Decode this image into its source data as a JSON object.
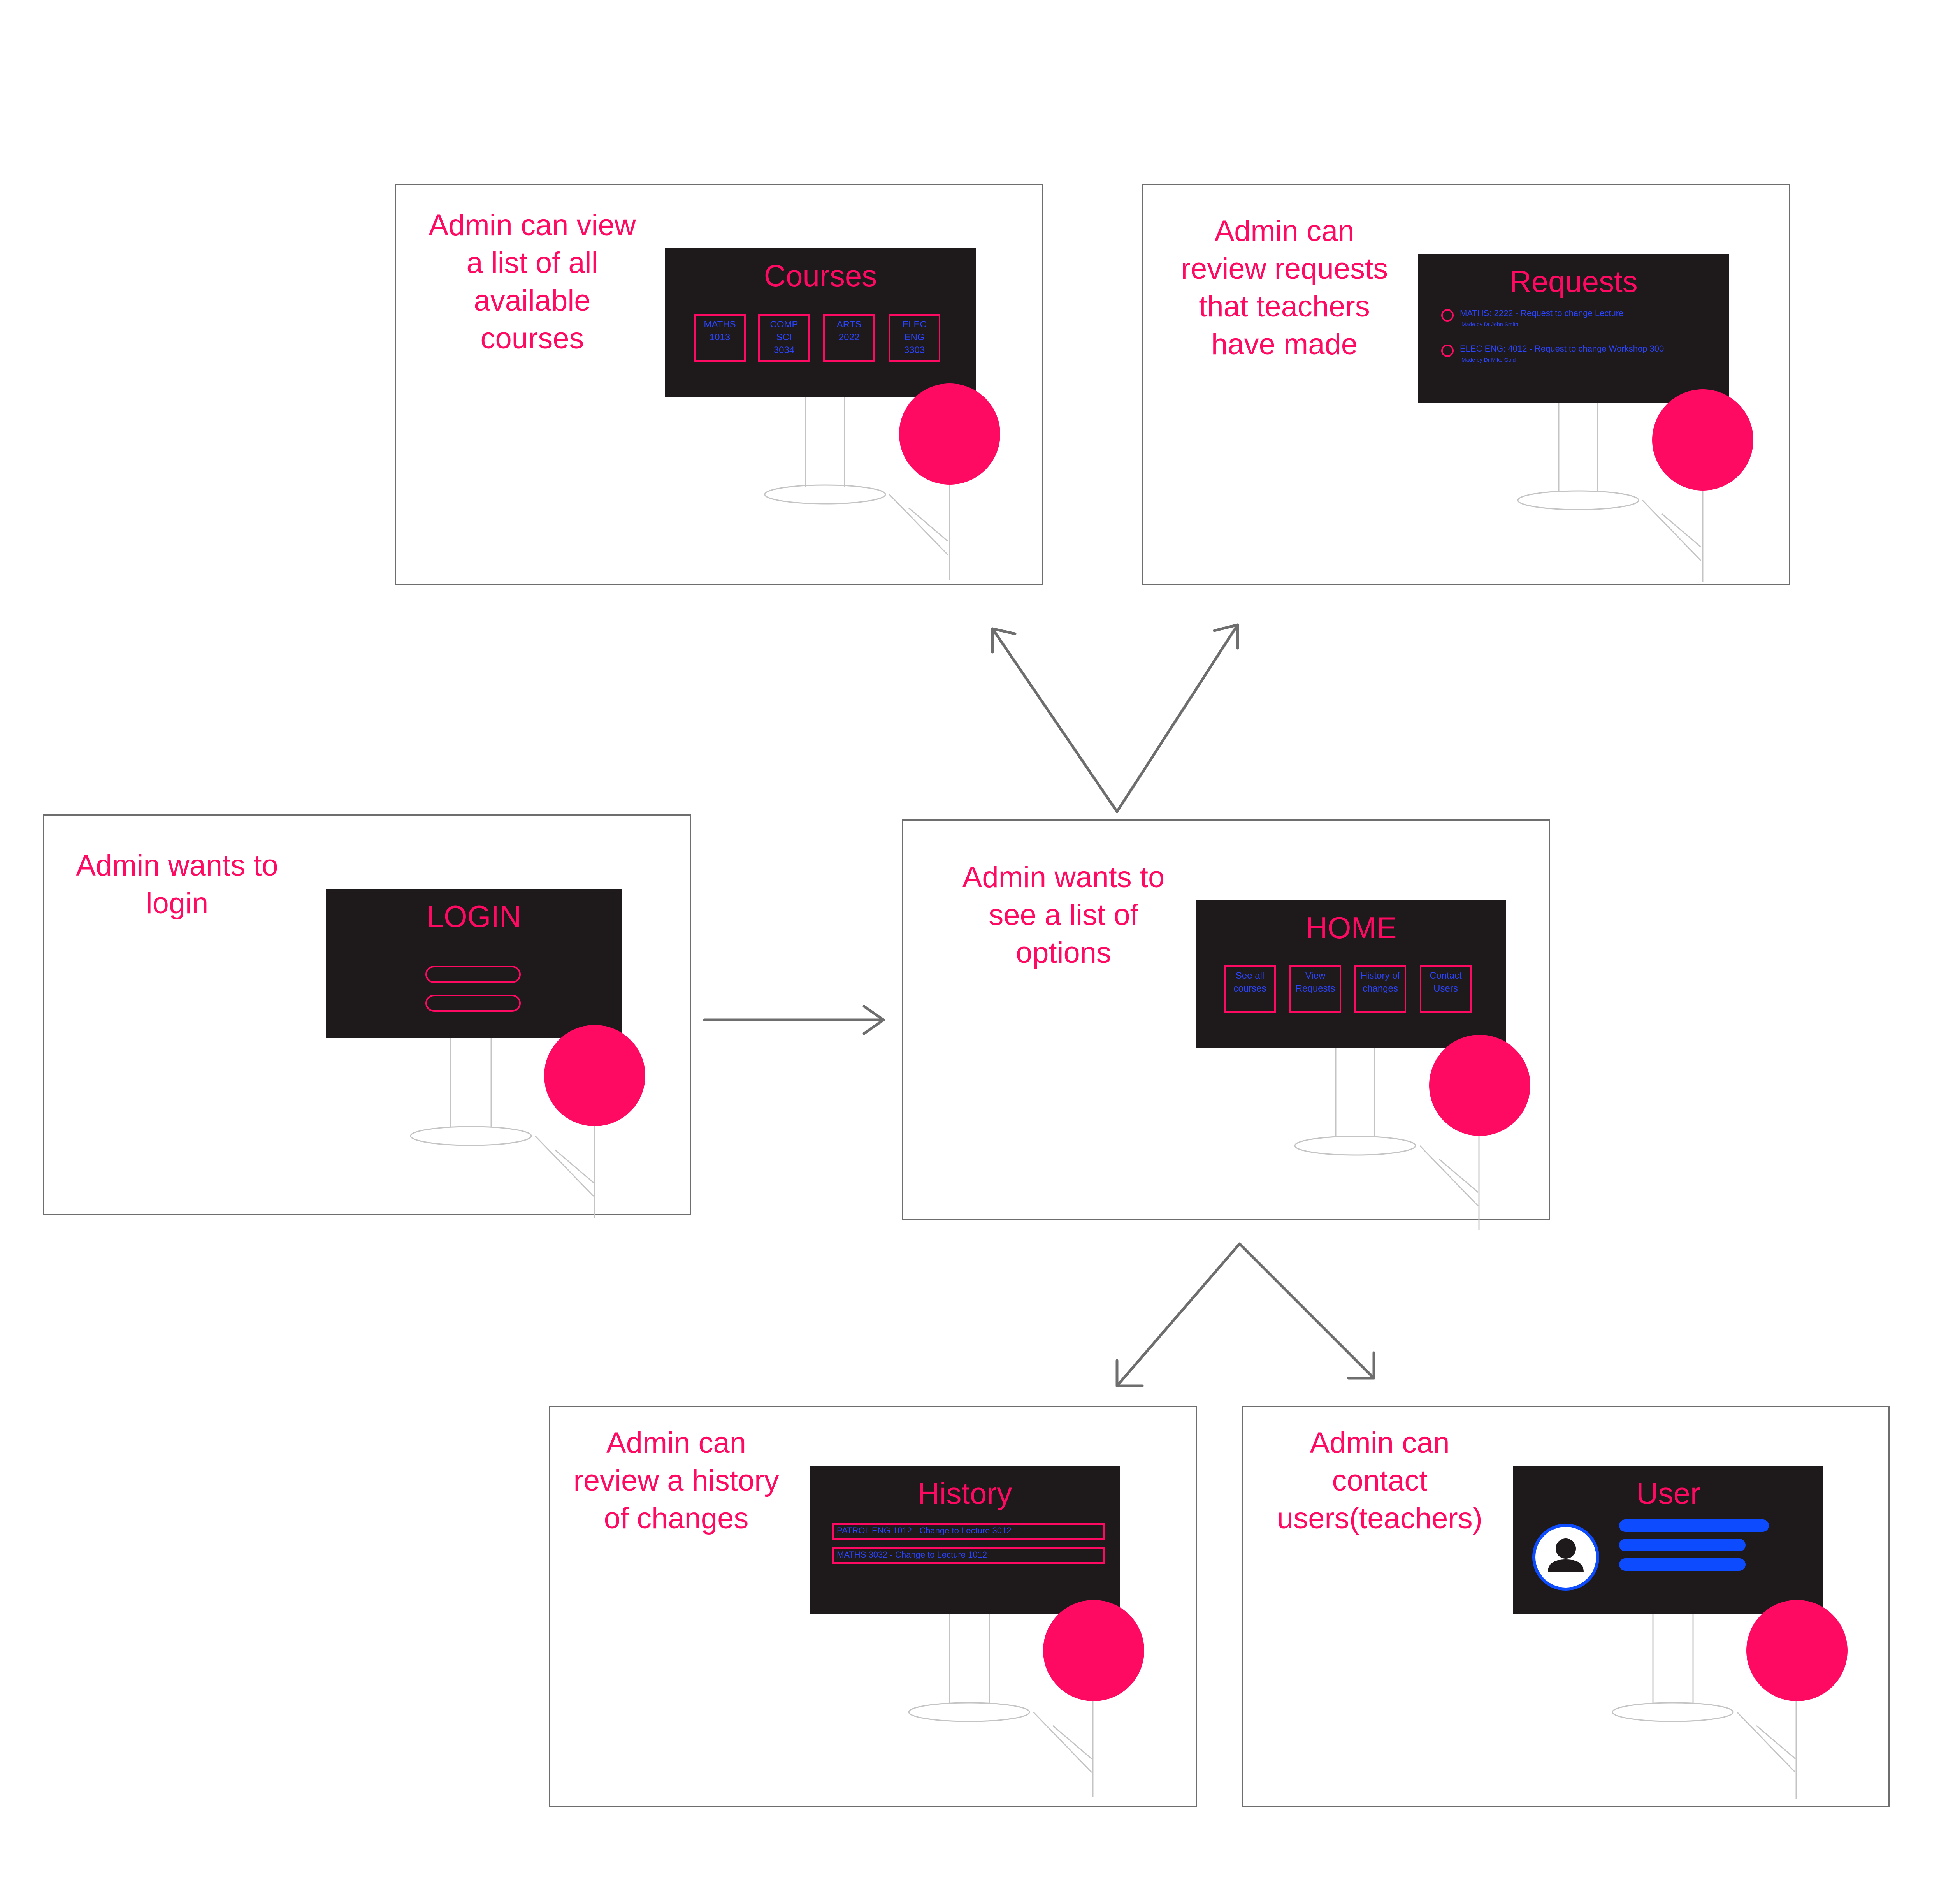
{
  "colors": {
    "accent": "#ff0a63",
    "board": "#1e191a",
    "link_text": "#2b44ff",
    "bar": "#0d4bff",
    "frame": "#6e6e6e",
    "arrow": "#6e6e6e"
  },
  "icons": {
    "avatar": "user-avatar-icon",
    "person": "person-stand-icon",
    "arrow": "arrow-icon"
  },
  "panels": {
    "courses": {
      "caption": "Admin can view\na list of all\navailable\ncourses",
      "title": "Courses",
      "tiles": [
        "MATHS\n1013",
        "COMP\nSCI\n3034",
        "ARTS\n2022",
        "ELEC\nENG\n3303"
      ]
    },
    "requests": {
      "caption": "Admin can\nreview requests\nthat teachers\nhave made",
      "title": "Requests",
      "items": [
        {
          "text": "MATHS: 2222 - Request to change Lecture",
          "by": "Made by Dr John Smith"
        },
        {
          "text": "ELEC ENG: 4012 - Request to change Workshop 300",
          "by": "Made by Dr Mike Gold"
        }
      ]
    },
    "login": {
      "caption": "Admin wants to\nlogin",
      "title": "LOGIN"
    },
    "home": {
      "caption": "Admin wants to\nsee a list of\noptions",
      "title": "HOME",
      "tiles": [
        "See all\ncourses",
        "View\nRequests",
        "History of\nchanges",
        "Contact\nUsers"
      ]
    },
    "history": {
      "caption": "Admin can\nreview a history\nof changes",
      "title": "History",
      "rows": [
        "PATROL ENG 1012 - Change to Lecture 3012",
        "MATHS 3032 - Change to Lecture 1012"
      ]
    },
    "user": {
      "caption": "Admin can\ncontact\nusers(teachers)",
      "title": "User"
    }
  }
}
